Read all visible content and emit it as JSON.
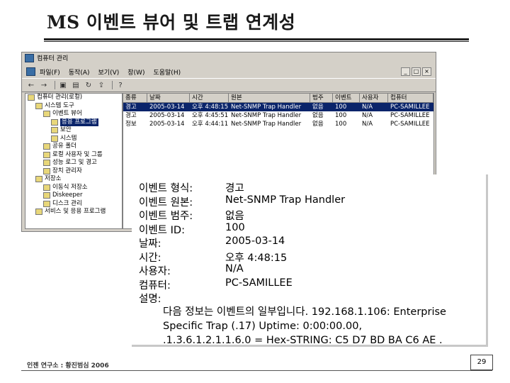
{
  "slide": {
    "title": "MS 이벤트 뷰어 및 트랩 연계성",
    "footer": "인젠 연구소 : 황진범심 2006",
    "page_number": "29"
  },
  "window": {
    "title": "컴퓨터 관리",
    "menu": [
      "파일(F)",
      "동작(A)",
      "보기(V)",
      "창(W)",
      "도움말(H)"
    ],
    "controls": [
      "_",
      "□",
      "×"
    ],
    "toolbar_icons": [
      "back-arrow-icon",
      "forward-arrow-icon",
      "up-folder-icon",
      "properties-icon",
      "refresh-icon",
      "export-icon",
      "help-icon"
    ]
  },
  "tree": [
    {
      "label": "컴퓨터 관리(로컬)",
      "indent": 0
    },
    {
      "label": "시스템 도구",
      "indent": 1
    },
    {
      "label": "이벤트 뷰어",
      "indent": 2
    },
    {
      "label": "응용 프로그램",
      "indent": 3,
      "selected": true
    },
    {
      "label": "보안",
      "indent": 3
    },
    {
      "label": "시스템",
      "indent": 3
    },
    {
      "label": "공유 폴더",
      "indent": 2
    },
    {
      "label": "로컬 사용자 및 그룹",
      "indent": 2
    },
    {
      "label": "성능 로그 및 경고",
      "indent": 2
    },
    {
      "label": "장치 관리자",
      "indent": 2
    },
    {
      "label": "저장소",
      "indent": 1
    },
    {
      "label": "이동식 저장소",
      "indent": 2
    },
    {
      "label": "Diskeeper",
      "indent": 2
    },
    {
      "label": "디스크 관리",
      "indent": 2
    },
    {
      "label": "서비스 및 응용 프로그램",
      "indent": 1
    }
  ],
  "list": {
    "headers": [
      "종류",
      "날짜",
      "시간",
      "원본",
      "범주",
      "이벤트",
      "사용자",
      "컴퓨터"
    ],
    "rows": [
      {
        "type": "경고",
        "date": "2005-03-14",
        "time": "오후 4:48:15",
        "source": "Net-SNMP Trap Handler",
        "category": "없음",
        "event": "100",
        "user": "N/A",
        "computer": "PC-SAMILLEE",
        "selected": true
      },
      {
        "type": "경고",
        "date": "2005-03-14",
        "time": "오후 4:45:51",
        "source": "Net-SNMP Trap Handler",
        "category": "없음",
        "event": "100",
        "user": "N/A",
        "computer": "PC-SAMILLEE"
      },
      {
        "type": "정보",
        "date": "2005-03-14",
        "time": "오후 4:44:11",
        "source": "Net-SNMP Trap Handler",
        "category": "없음",
        "event": "100",
        "user": "N/A",
        "computer": "PC-SAMILLEE"
      }
    ]
  },
  "details": [
    {
      "label": "이벤트 형식:",
      "value": "경고"
    },
    {
      "label": "이벤트 원본:",
      "value": "Net-SNMP Trap Handler"
    },
    {
      "label": "이벤트 범주:",
      "value": "없음"
    },
    {
      "label": "이벤트 ID:",
      "value": "100"
    },
    {
      "label": "날짜:",
      "value": "2005-03-14"
    },
    {
      "label": "시간:",
      "value": "오후 4:48:15"
    },
    {
      "label": "사용자:",
      "value": "N/A"
    },
    {
      "label": "컴퓨터:",
      "value": "PC-SAMILLEE"
    },
    {
      "label": "설명:",
      "value": ""
    }
  ],
  "description_lines": [
    "다음 정보는 이벤트의 일부입니다. 192.168.1.106: Enterprise",
    "Specific Trap (.17) Uptime: 0:00:00.00,",
    ".1.3.6.1.2.1.1.6.0 = Hex-STRING: C5 D7 BD BA C6 AE ."
  ]
}
